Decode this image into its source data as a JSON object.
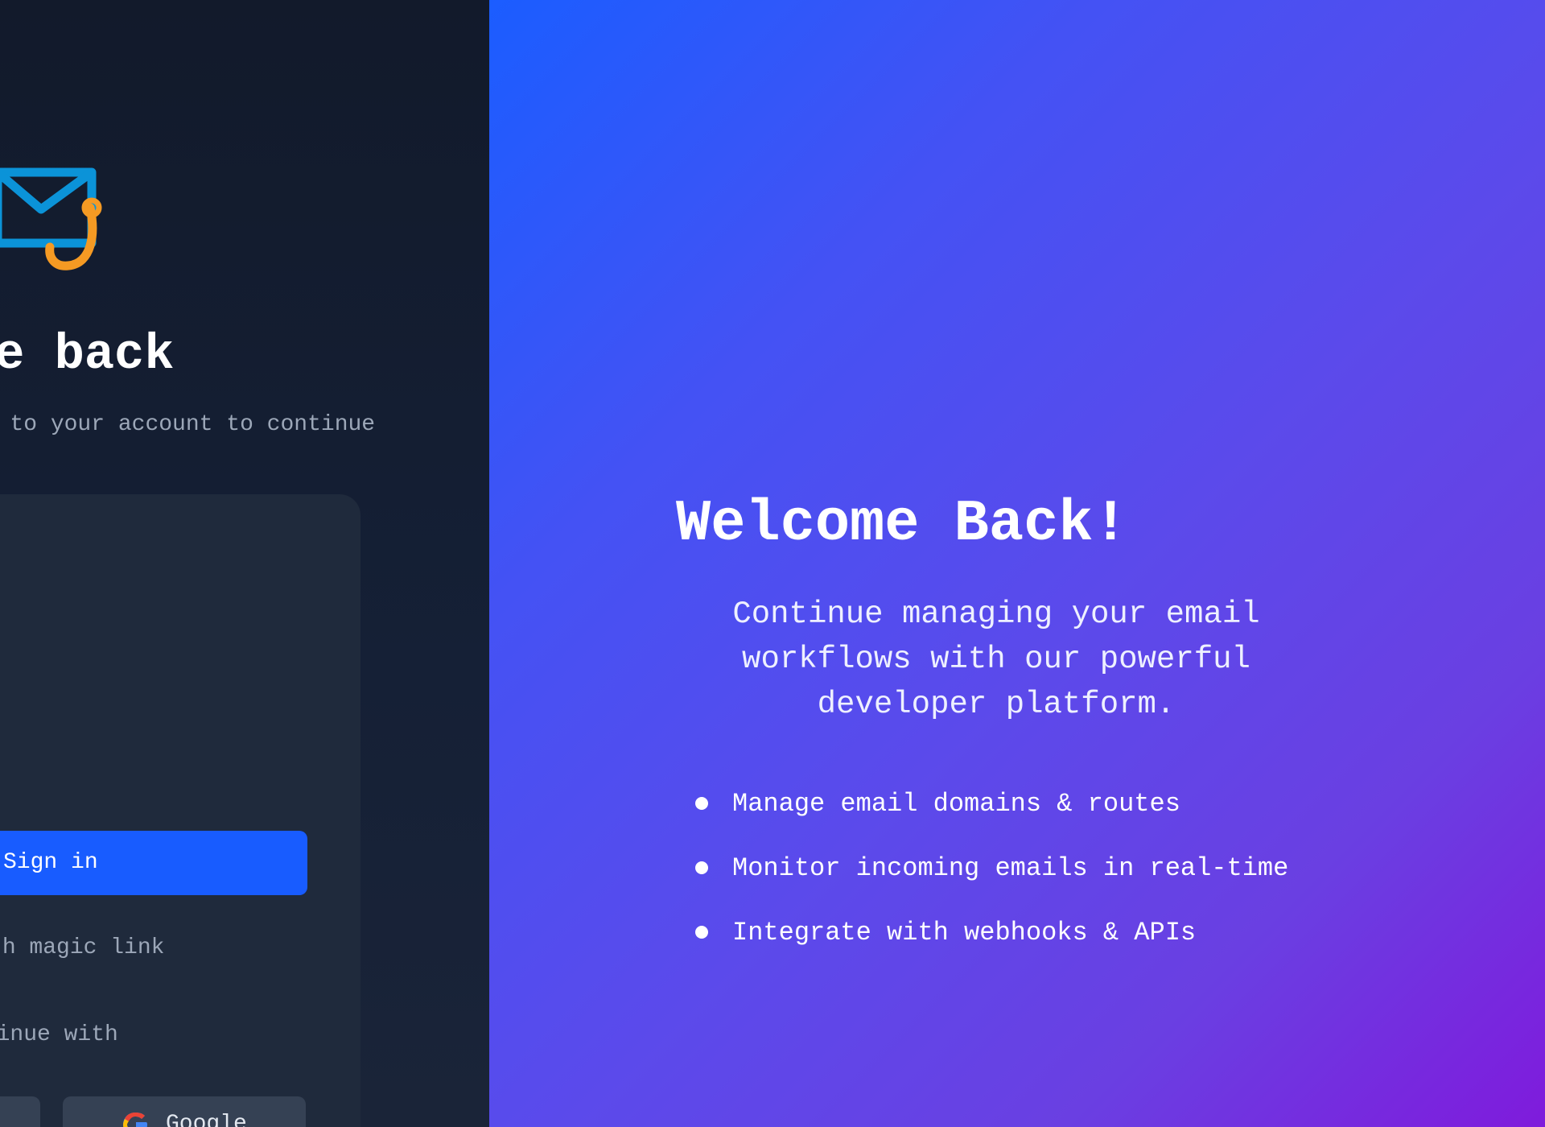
{
  "login": {
    "title": "Welcome back",
    "subtitle": "Sign in to your account to continue",
    "sign_in_label": "Sign in",
    "magic_link_label": "Sign in with magic link",
    "divider_label": "Or continue with",
    "social": {
      "google_label": "Google"
    }
  },
  "hero": {
    "title": "Welcome Back!",
    "description": "Continue managing your email workflows with our powerful developer platform.",
    "features": [
      "Manage email domains & routes",
      "Monitor incoming emails in real-time",
      "Integrate with webhooks & APIs"
    ]
  },
  "colors": {
    "left_background": "#121a2b",
    "card_background": "#1f2a3c",
    "primary_button": "#185cff",
    "logo_envelope": "#0b93d8",
    "logo_hook": "#f59a23",
    "hero_gradient_start": "#1b5dff",
    "hero_gradient_end": "#7f1bdc"
  },
  "icons": {
    "logo": "envelope-hook-icon",
    "google": "google-icon"
  }
}
